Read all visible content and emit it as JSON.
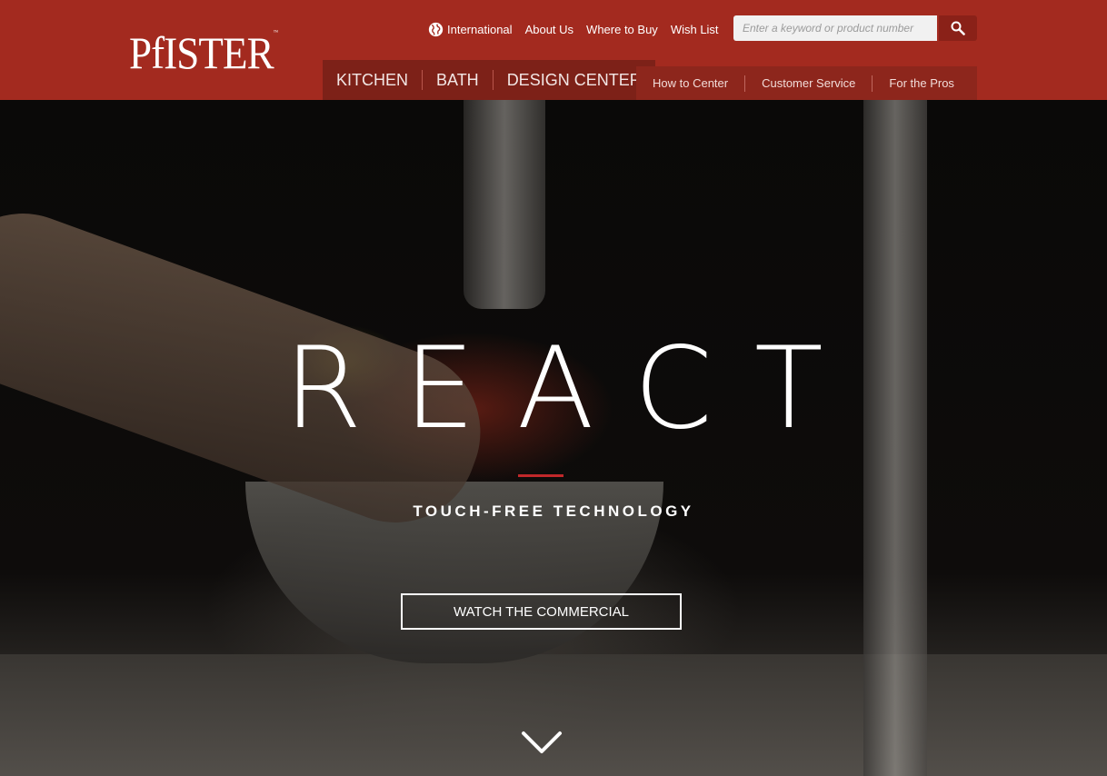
{
  "brand": {
    "logo_text": "PfISTER",
    "trademark": "™"
  },
  "utility_nav": {
    "international": "International",
    "about": "About Us",
    "where_to_buy": "Where to Buy",
    "wish_list": "Wish List"
  },
  "search": {
    "placeholder": "Enter a keyword or product number",
    "icon": "search-icon"
  },
  "main_nav": [
    "KITCHEN",
    "BATH",
    "DESIGN CENTER"
  ],
  "sub_nav": [
    "How to Center",
    "Customer Service",
    "For the Pros"
  ],
  "hero": {
    "headline": "REACT",
    "tagline": "TOUCH-FREE TECHNOLOGY",
    "cta_label": "WATCH THE COMMERCIAL",
    "scroll_icon": "chevron-down-icon"
  },
  "colors": {
    "brand_red": "#a32a1f",
    "accent_rule": "#c0282a"
  }
}
